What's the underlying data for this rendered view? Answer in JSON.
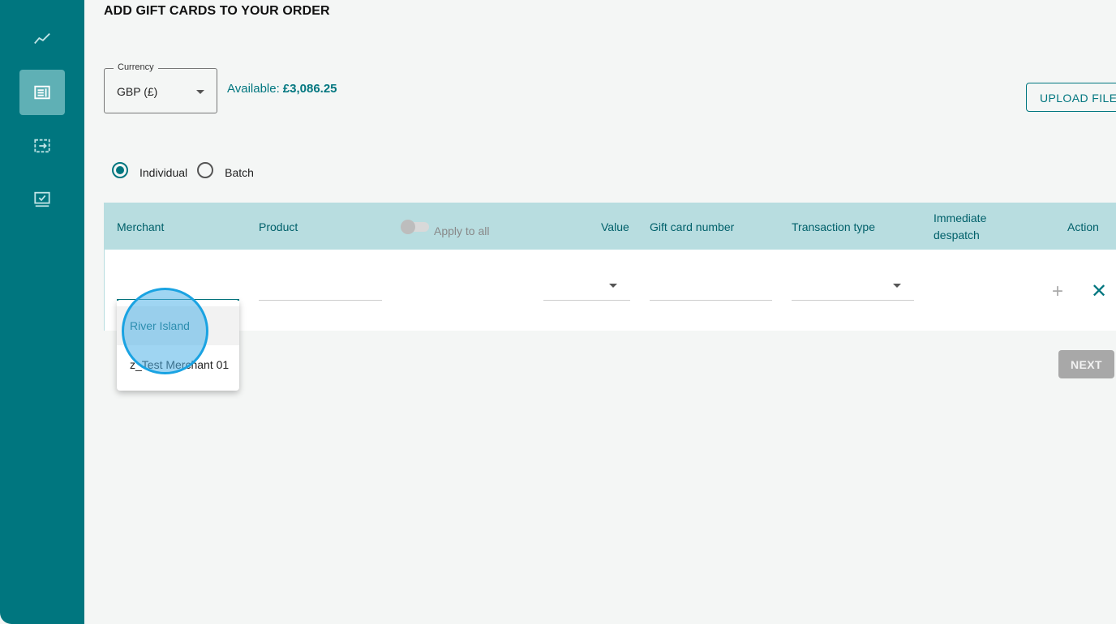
{
  "sidebar": {
    "items": [
      {
        "icon": "line-chart-icon",
        "active": false
      },
      {
        "icon": "order-document-icon",
        "active": true
      },
      {
        "icon": "transfer-icon",
        "active": false
      },
      {
        "icon": "checked-screen-icon",
        "active": false
      }
    ]
  },
  "page": {
    "title": "ADD GIFT CARDS TO YOUR ORDER"
  },
  "currency": {
    "label": "Currency",
    "value": "GBP (£)"
  },
  "available": {
    "label": "Available:",
    "amount": "£3,086.25"
  },
  "upload_label": "UPLOAD FILE",
  "mode": {
    "individual": "Individual",
    "batch": "Batch",
    "selected": "Individual"
  },
  "table": {
    "headers": {
      "merchant": "Merchant",
      "product": "Product",
      "apply_all": "Apply to all",
      "value": "Value",
      "gift_card_number": "Gift card number",
      "transaction_type": "Transaction type",
      "immediate_despatch_line1": "Immediate",
      "immediate_despatch_line2": "despatch",
      "action": "Action"
    }
  },
  "dropdown": {
    "options": [
      "River Island",
      "z_Test Merchant 01"
    ],
    "hovered": "River Island"
  },
  "next_label": "NEXT",
  "colors": {
    "primary": "#00767f",
    "header_bg": "#b8dde0",
    "sidebar_active": "#5fb0b5",
    "disabled": "#a8a8a8"
  }
}
